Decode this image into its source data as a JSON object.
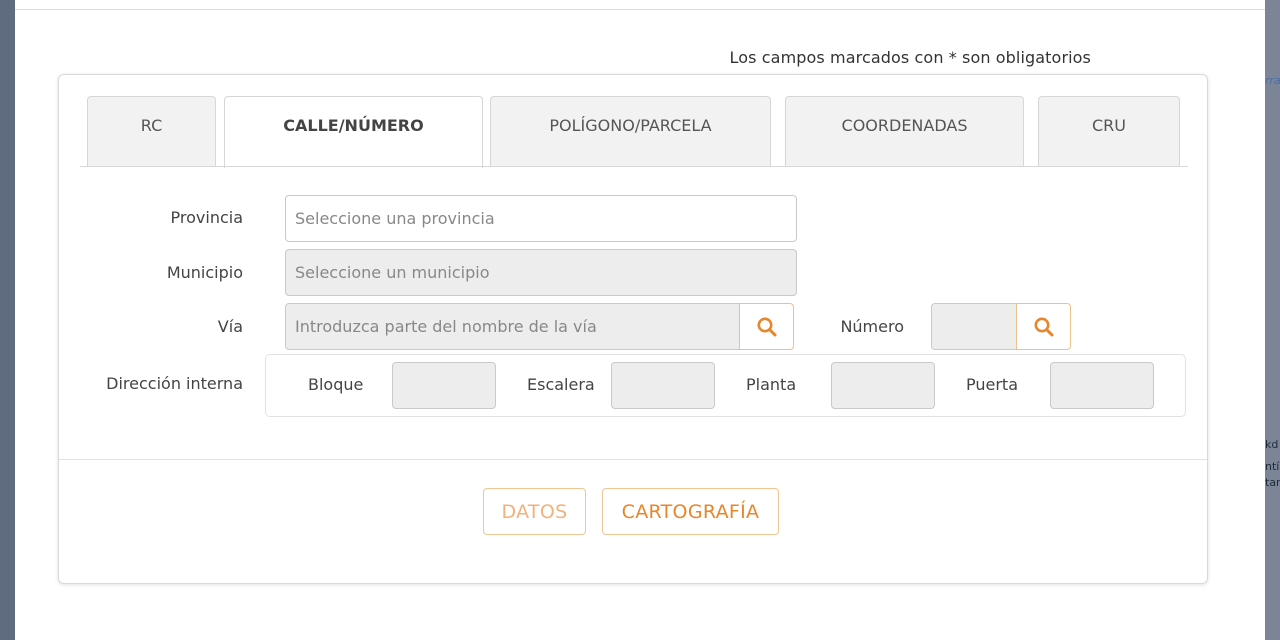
{
  "backdrop": {
    "fragments": [
      "rra",
      "kd",
      "ntí",
      "tar"
    ]
  },
  "header": {
    "required_note": "Los campos marcados con * son obligatorios"
  },
  "tabs": [
    {
      "label": "RC",
      "active": false
    },
    {
      "label": "CALLE/NÚMERO",
      "active": true
    },
    {
      "label": "POLÍGONO/PARCELA",
      "active": false
    },
    {
      "label": "COORDENADAS",
      "active": false
    },
    {
      "label": "CRU",
      "active": false
    }
  ],
  "form": {
    "provincia": {
      "label": "Provincia",
      "placeholder": "Seleccione una provincia",
      "value": ""
    },
    "municipio": {
      "label": "Municipio",
      "placeholder": "Seleccione un municipio",
      "value": ""
    },
    "via": {
      "label": "Vía",
      "placeholder": "Introduzca parte del nombre de la vía",
      "value": ""
    },
    "numero": {
      "label": "Número",
      "value": ""
    },
    "direccion_interna": {
      "label": "Dirección interna",
      "bloque": {
        "label": "Bloque",
        "value": ""
      },
      "escalera": {
        "label": "Escalera",
        "value": ""
      },
      "planta": {
        "label": "Planta",
        "value": ""
      },
      "puerta": {
        "label": "Puerta",
        "value": ""
      }
    }
  },
  "actions": {
    "datos": "DATOS",
    "cartografia": "CARTOGRAFÍA"
  },
  "icons": {
    "search": "magnifier-icon"
  },
  "colors": {
    "accent": "#e8862a",
    "accent_light": "#f0b27a",
    "border_accent": "#f1c594",
    "input_disabled": "#ededed",
    "backdrop": "#5f6b7e"
  }
}
